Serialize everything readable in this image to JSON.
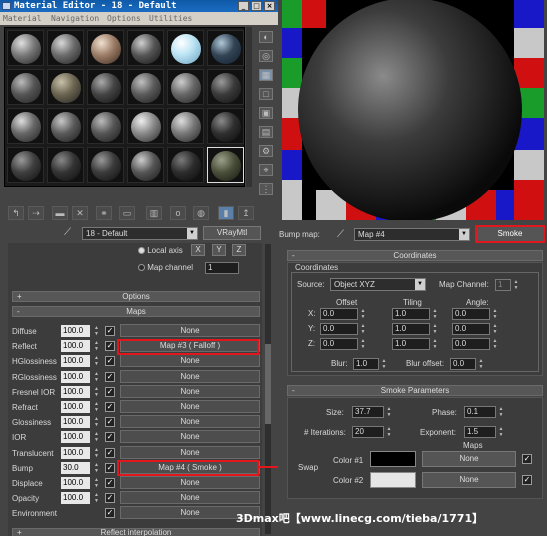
{
  "window": {
    "title": "Material Editor - 18 - Default",
    "menu": [
      "Material",
      "Navigation",
      "Options",
      "Utilities"
    ]
  },
  "material_selector": {
    "value": "18 - Default",
    "type_button": "VRayMtl"
  },
  "coord_fragment": {
    "local_axis": "Local axis",
    "x": "X",
    "y": "Y",
    "z": "Z",
    "map_channel_label": "Map channel",
    "map_channel_value": "1"
  },
  "rollouts": {
    "options": "Options",
    "maps": "Maps",
    "reflect_interpolation": "Reflect interpolation"
  },
  "maps": [
    {
      "name": "Diffuse",
      "amount": "100.0",
      "checked": true,
      "map": "None"
    },
    {
      "name": "Reflect",
      "amount": "100.0",
      "checked": true,
      "map": "Map #3  ( Falloff )"
    },
    {
      "name": "HGlossiness",
      "amount": "100.0",
      "checked": true,
      "map": "None"
    },
    {
      "name": "RGlossiness",
      "amount": "100.0",
      "checked": true,
      "map": "None"
    },
    {
      "name": "Fresnel IOR",
      "amount": "100.0",
      "checked": true,
      "map": "None"
    },
    {
      "name": "Refract",
      "amount": "100.0",
      "checked": true,
      "map": "None"
    },
    {
      "name": "Glossiness",
      "amount": "100.0",
      "checked": true,
      "map": "None"
    },
    {
      "name": "IOR",
      "amount": "100.0",
      "checked": true,
      "map": "None"
    },
    {
      "name": "Translucent",
      "amount": "100.0",
      "checked": true,
      "map": "None"
    },
    {
      "name": "Bump",
      "amount": "30.0",
      "checked": true,
      "map": "Map #4  ( Smoke )"
    },
    {
      "name": "Displace",
      "amount": "100.0",
      "checked": true,
      "map": "None"
    },
    {
      "name": "Opacity",
      "amount": "100.0",
      "checked": true,
      "map": "None"
    },
    {
      "name": "Environment",
      "amount": "",
      "checked": true,
      "map": "None"
    }
  ],
  "bump_map": {
    "label": "Bump map:",
    "value": "Map #4",
    "type_button": "Smoke"
  },
  "coordinates": {
    "header": "Coordinates",
    "group": "Coordinates",
    "source_label": "Source:",
    "source_value": "Object XYZ",
    "map_channel_label": "Map Channel:",
    "map_channel_value": "1",
    "col_offset": "Offset",
    "col_tiling": "Tiling",
    "col_angle": "Angle:",
    "rows": [
      {
        "axis": "X:",
        "offset": "0.0",
        "tiling": "1.0",
        "angle": "0.0"
      },
      {
        "axis": "Y:",
        "offset": "0.0",
        "tiling": "1.0",
        "angle": "0.0"
      },
      {
        "axis": "Z:",
        "offset": "0.0",
        "tiling": "1.0",
        "angle": "0.0"
      }
    ],
    "blur_label": "Blur:",
    "blur_value": "1.0",
    "blur_offset_label": "Blur offset:",
    "blur_offset_value": "0.0"
  },
  "smoke": {
    "header": "Smoke Parameters",
    "size_label": "Size:",
    "size_value": "37.7",
    "phase_label": "Phase:",
    "phase_value": "0.1",
    "iterations_label": "# Iterations:",
    "iterations_value": "20",
    "exponent_label": "Exponent:",
    "exponent_value": "1.5",
    "maps_label": "Maps",
    "swap_label": "Swap",
    "color1_label": "Color #1",
    "color1_map": "None",
    "color2_label": "Color #2",
    "color2_map": "None"
  },
  "colors": {
    "color1": "#000000",
    "color2": "#e6e6e6",
    "highlight": "#e0171c"
  },
  "watermark": "3Dmax吧【www.linecg.com/tieba/1771】"
}
